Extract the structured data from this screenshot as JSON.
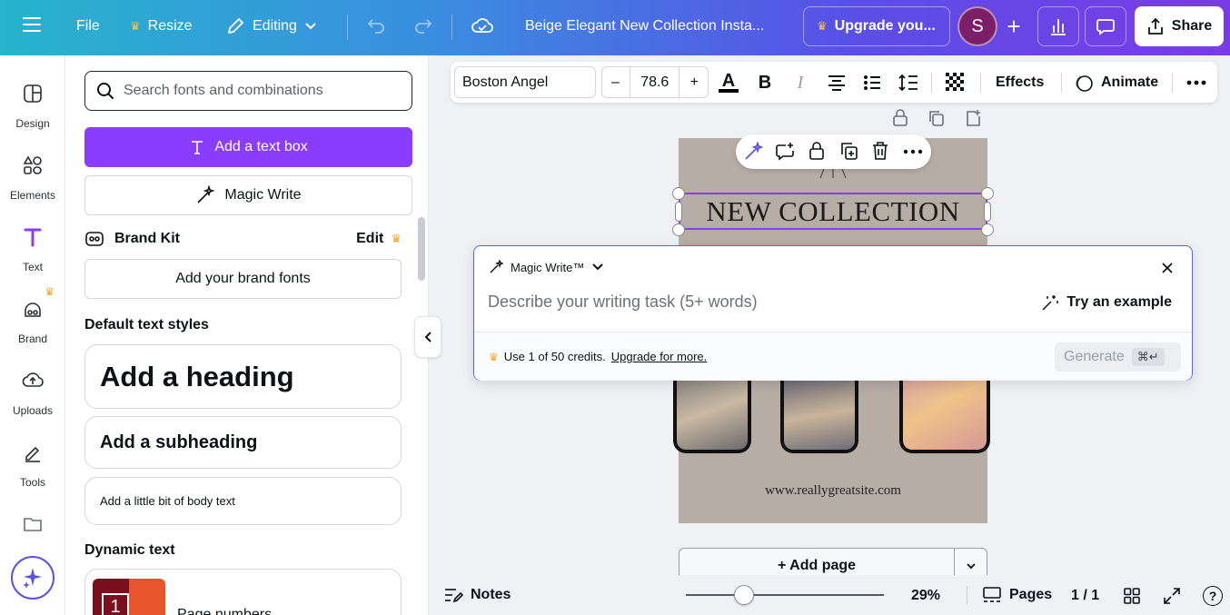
{
  "topbar": {
    "file": "File",
    "resize": "Resize",
    "editing": "Editing",
    "doc_title": "Beige Elegant New Collection Insta...",
    "upgrade": "Upgrade you...",
    "avatar_initial": "S",
    "share": "Share"
  },
  "rail": {
    "items": [
      {
        "label": "Design",
        "icon": "design-icon"
      },
      {
        "label": "Elements",
        "icon": "elements-icon"
      },
      {
        "label": "Text",
        "icon": "text-icon"
      },
      {
        "label": "Brand",
        "icon": "brand-icon"
      },
      {
        "label": "Uploads",
        "icon": "uploads-icon"
      },
      {
        "label": "Tools",
        "icon": "tools-icon"
      }
    ]
  },
  "panel": {
    "search_placeholder": "Search fonts and combinations",
    "add_text_box": "Add a text box",
    "magic_write": "Magic Write",
    "brand_kit": "Brand Kit",
    "brand_edit": "Edit",
    "add_brand_fonts": "Add your brand fonts",
    "default_styles": "Default text styles",
    "heading": "Add a heading",
    "subheading": "Add a subheading",
    "body": "Add a little bit of body text",
    "dynamic_text": "Dynamic text",
    "page_numbers": "Page numbers"
  },
  "toolbar": {
    "font": "Boston Angel",
    "minus": "–",
    "size": "78.6",
    "plus": "+",
    "effects": "Effects",
    "animate": "Animate"
  },
  "design": {
    "title": "NEW COLLECTION",
    "url": "www.reallygreatsite.com"
  },
  "magic": {
    "title": "Magic Write™",
    "placeholder": "Describe your writing task (5+ words)",
    "try_example": "Try an example",
    "credits": "Use 1 of 50 credits.",
    "upgrade_link": "Upgrade for more.",
    "generate": "Generate",
    "shortcut": "⌘↵"
  },
  "bottom": {
    "add_page": "+ Add page",
    "notes": "Notes",
    "zoom": "29%",
    "pages": "Pages",
    "page_count": "1 / 1"
  },
  "colors": {
    "accent": "#8b3dff",
    "crown": "#f5a623",
    "design_bg": "#b6ada5"
  }
}
